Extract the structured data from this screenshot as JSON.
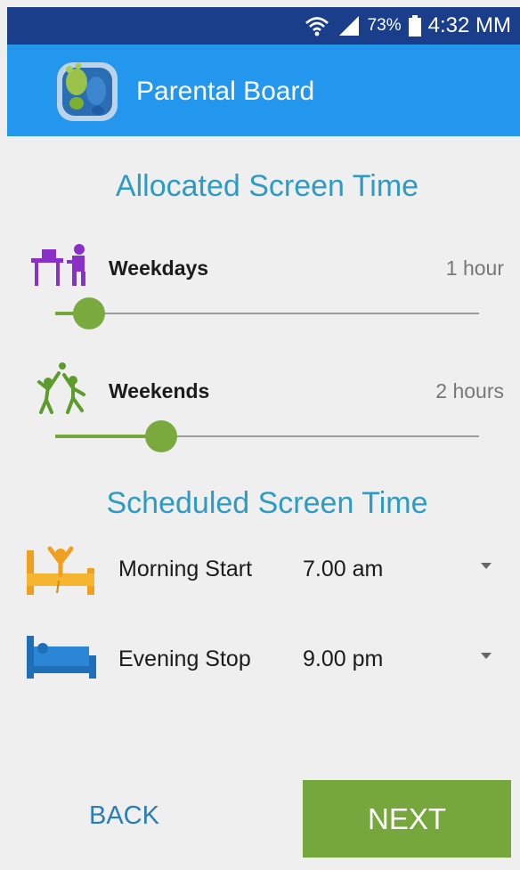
{
  "status_bar": {
    "battery_percent": "73%",
    "time": "4:32 MM"
  },
  "app_bar": {
    "title": "Parental Board"
  },
  "allocated": {
    "title": "Allocated Screen Time",
    "weekdays": {
      "label": "Weekdays",
      "value": "1 hour",
      "slider_fraction": 0.08
    },
    "weekends": {
      "label": "Weekends",
      "value": "2 hours",
      "slider_fraction": 0.25
    }
  },
  "scheduled": {
    "title": "Scheduled Screen Time",
    "morning": {
      "label": "Morning Start",
      "time": "7.00 am"
    },
    "evening": {
      "label": "Evening Stop",
      "time": "9.00 pm"
    }
  },
  "buttons": {
    "back": "BACK",
    "next": "NEXT"
  },
  "colors": {
    "status_bar": "#1a3e8a",
    "app_bar": "#2396ee",
    "accent_blue": "#2e9bc4",
    "slider_green": "#76a73c",
    "next_button": "#76a73c"
  },
  "icons": {
    "weekdays": "desk-study-icon",
    "weekends": "play-kids-icon",
    "morning": "wake-up-bed-icon",
    "evening": "sleep-bed-icon"
  }
}
